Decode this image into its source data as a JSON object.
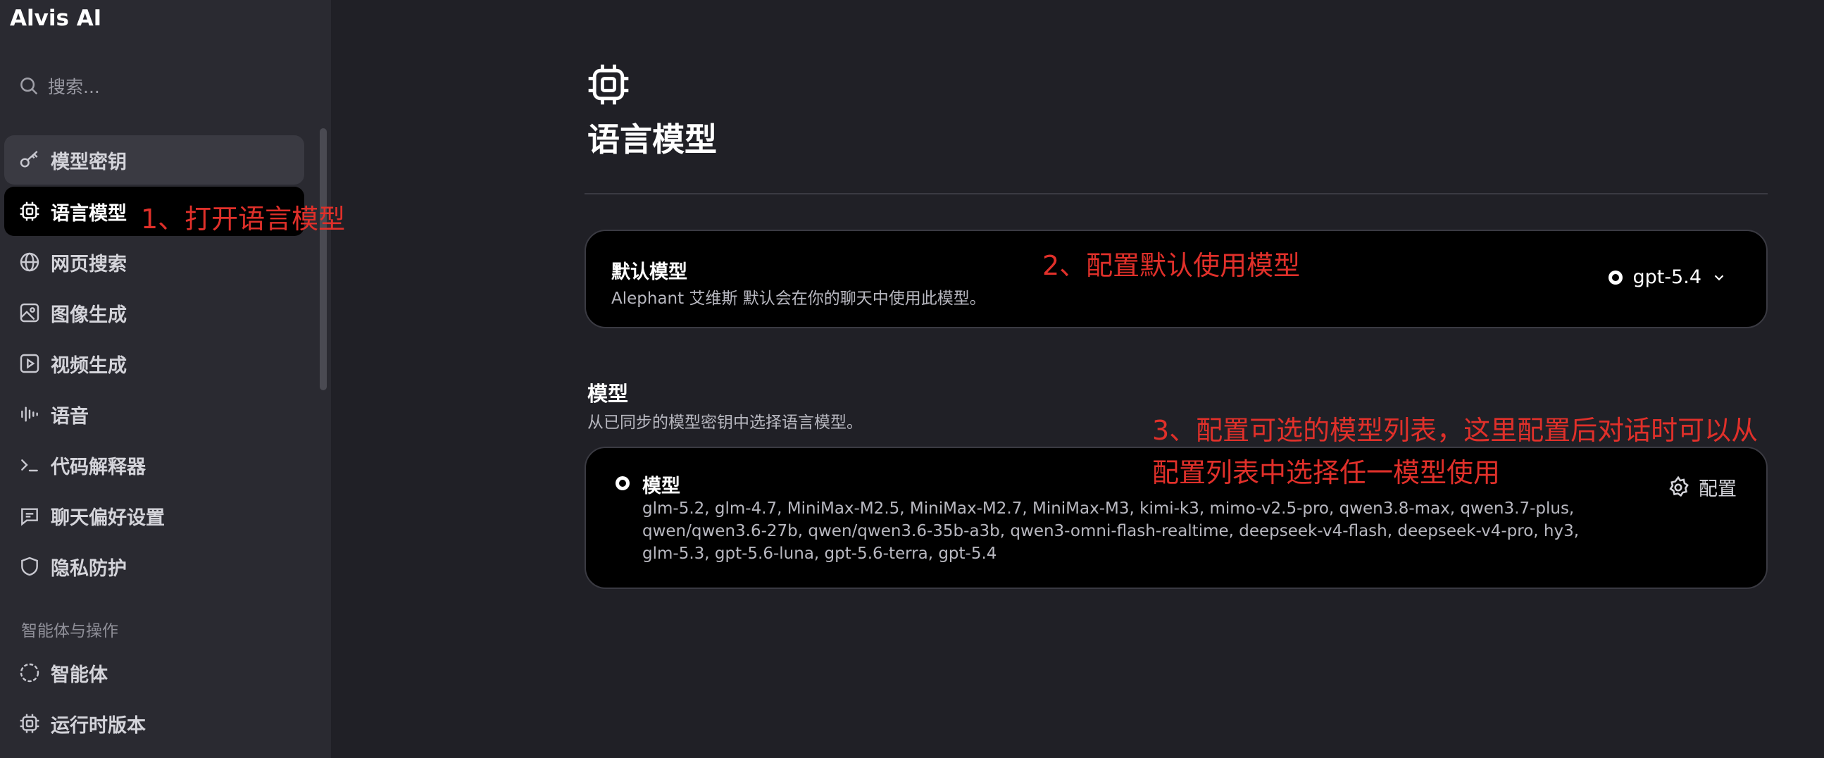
{
  "app": {
    "title": "Alvis AI"
  },
  "search": {
    "placeholder": "搜索..."
  },
  "sidebar": {
    "items": [
      {
        "label": "模型密钥"
      },
      {
        "label": "语言模型"
      },
      {
        "label": "网页搜索"
      },
      {
        "label": "图像生成"
      },
      {
        "label": "视频生成"
      },
      {
        "label": "语音"
      },
      {
        "label": "代码解释器"
      },
      {
        "label": "聊天偏好设置"
      },
      {
        "label": "隐私防护"
      }
    ],
    "section_label": "智能体与操作",
    "section_items": [
      {
        "label": "智能体"
      },
      {
        "label": "运行时版本"
      }
    ]
  },
  "main": {
    "title": "语言模型",
    "default_model": {
      "title": "默认模型",
      "description": "Alephant 艾维斯 默认会在你的聊天中使用此模型。",
      "selected": "gpt-5.4"
    },
    "models_section": {
      "title": "模型",
      "description": "从已同步的模型密钥中选择语言模型。",
      "card_title": "模型",
      "list": "glm-5.2, glm-4.7, MiniMax-M2.5, MiniMax-M2.7, MiniMax-M3, kimi-k3, mimo-v2.5-pro, qwen3.8-max, qwen3.7-plus, qwen/qwen3.6-27b, qwen/qwen3.6-35b-a3b, qwen3-omni-flash-realtime, deepseek-v4-flash, deepseek-v4-pro, hy3, glm-5.3, gpt-5.6-luna, gpt-5.6-terra, gpt-5.4",
      "config_label": "配置"
    }
  },
  "annotations": {
    "step1": "1、打开语言模型",
    "step2": "2、配置默认使用模型",
    "step3_line1": "3、配置可选的模型列表，这里配置后对话时可以从",
    "step3_line2": "配置列表中选择任一模型使用"
  },
  "colors": {
    "annotation": "#e0302a",
    "card_bg": "#000000",
    "sidebar_bg": "#2a2a31",
    "main_bg": "#202026"
  }
}
